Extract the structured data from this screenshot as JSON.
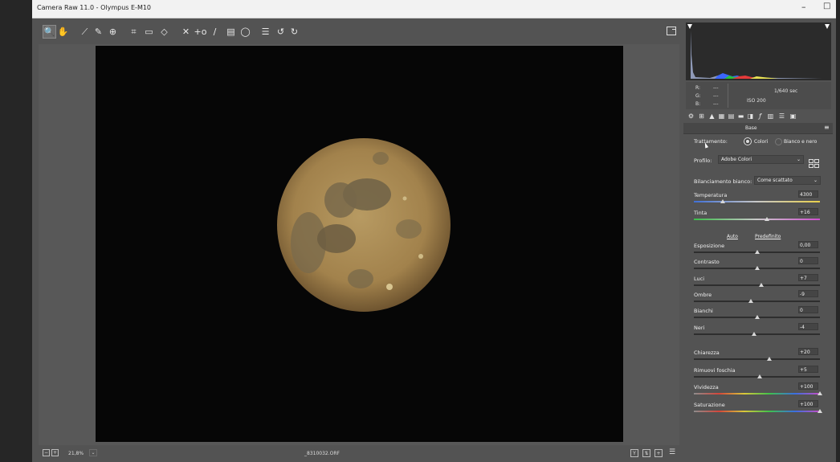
{
  "window": {
    "title": "Camera Raw 11.0  -  Olympus E-M10",
    "minimize": "–",
    "maximize": "□"
  },
  "toolbar": {
    "tools": [
      {
        "name": "zoom-tool-icon",
        "glyph": "🔍"
      },
      {
        "name": "hand-tool-icon",
        "glyph": "✋"
      },
      {
        "name": "white-balance-tool-icon",
        "glyph": "⟋"
      },
      {
        "name": "color-sampler-tool-icon",
        "glyph": "✎"
      },
      {
        "name": "targeted-adjustment-tool-icon",
        "glyph": "⊕"
      },
      {
        "name": "crop-tool-icon",
        "glyph": "⌗"
      },
      {
        "name": "straighten-tool-icon",
        "glyph": "▭"
      },
      {
        "name": "transform-tool-icon",
        "glyph": "◇"
      },
      {
        "name": "spot-removal-tool-icon",
        "glyph": "✕"
      },
      {
        "name": "red-eye-tool-icon",
        "glyph": "+o"
      },
      {
        "name": "adjustment-brush-icon",
        "glyph": "∕"
      },
      {
        "name": "graduated-filter-icon",
        "glyph": "▤"
      },
      {
        "name": "radial-filter-icon",
        "glyph": "◯"
      },
      {
        "name": "preferences-icon",
        "glyph": "☰"
      },
      {
        "name": "rotate-left-icon",
        "glyph": "↺"
      },
      {
        "name": "rotate-right-icon",
        "glyph": "↻"
      }
    ]
  },
  "status": {
    "zoom": "21,8%",
    "filename": "_8310032.ORF"
  },
  "readout": {
    "r_label": "R:",
    "g_label": "G:",
    "b_label": "B:",
    "r": "---",
    "g": "---",
    "b": "---",
    "shutter": "1/640 sec",
    "iso": "ISO 200"
  },
  "panel": {
    "title": "Base",
    "treatment_label": "Trattamento:",
    "treatment_color": "Colori",
    "treatment_bw": "Bianco e nero",
    "profile_label": "Profilo:",
    "profile_value": "Adobe Colori",
    "wb_label": "Bilanciamento bianco:",
    "wb_value": "Come scattato",
    "auto": "Auto",
    "default": "Predefinito"
  },
  "sliders": [
    {
      "key": "temperatura",
      "label": "Temperatura",
      "value": "4300",
      "pos": 0.23,
      "grad": "temp"
    },
    {
      "key": "tinta",
      "label": "Tinta",
      "value": "+16",
      "pos": 0.58,
      "grad": "tint"
    },
    {
      "key": "esposizione",
      "label": "Esposizione",
      "value": "0,00",
      "pos": 0.5
    },
    {
      "key": "contrasto",
      "label": "Contrasto",
      "value": "0",
      "pos": 0.5
    },
    {
      "key": "luci",
      "label": "Luci",
      "value": "+7",
      "pos": 0.535
    },
    {
      "key": "ombre",
      "label": "Ombre",
      "value": "-9",
      "pos": 0.455
    },
    {
      "key": "bianchi",
      "label": "Bianchi",
      "value": "0",
      "pos": 0.5
    },
    {
      "key": "neri",
      "label": "Neri",
      "value": "-4",
      "pos": 0.48
    },
    {
      "key": "chiarezza",
      "label": "Chiarezza",
      "value": "+20",
      "pos": 0.6
    },
    {
      "key": "rimuovi_foschia",
      "label": "Rimuovi foschia",
      "value": "+5",
      "pos": 0.525
    },
    {
      "key": "vividezza",
      "label": "Vividezza",
      "value": "+100",
      "pos": 1.0,
      "grad": "sat"
    },
    {
      "key": "saturazione",
      "label": "Saturazione",
      "value": "+100",
      "pos": 1.0,
      "grad": "sat"
    }
  ],
  "colors": {
    "accent": "#d9d9d9",
    "background": "#535353",
    "image_bg": "#060606"
  }
}
